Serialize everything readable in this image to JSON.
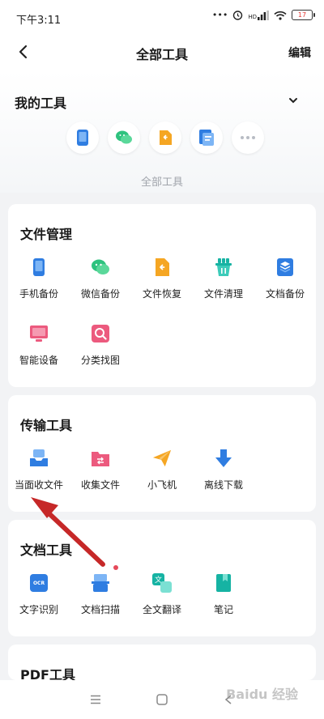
{
  "status": {
    "time": "下午3:11",
    "hd": "HD",
    "battery": "17"
  },
  "nav": {
    "title": "全部工具",
    "edit": "编辑"
  },
  "my_tools": {
    "title": "我的工具",
    "all_tools_link": "全部工具"
  },
  "sections": [
    {
      "title": "文件管理",
      "tools": [
        {
          "label": "手机备份"
        },
        {
          "label": "微信备份"
        },
        {
          "label": "文件恢复"
        },
        {
          "label": "文件清理"
        },
        {
          "label": "文档备份"
        },
        {
          "label": "智能设备"
        },
        {
          "label": "分类找图"
        }
      ]
    },
    {
      "title": "传输工具",
      "tools": [
        {
          "label": "当面收文件"
        },
        {
          "label": "收集文件"
        },
        {
          "label": "小飞机"
        },
        {
          "label": "离线下载"
        }
      ]
    },
    {
      "title": "文档工具",
      "tools": [
        {
          "label": "文字识别",
          "icon_text": "OCR"
        },
        {
          "label": "文档扫描"
        },
        {
          "label": "全文翻译",
          "icon_text": "文"
        },
        {
          "label": "笔记"
        }
      ]
    },
    {
      "title": "PDF工具"
    }
  ],
  "watermark": "Baidu 经验",
  "colors": {
    "blue": "#2f7de1",
    "green": "#2ec27e",
    "orange": "#f5a623",
    "teal": "#16b3a3",
    "pink": "#ec5a7e",
    "arrow": "#c62828"
  }
}
